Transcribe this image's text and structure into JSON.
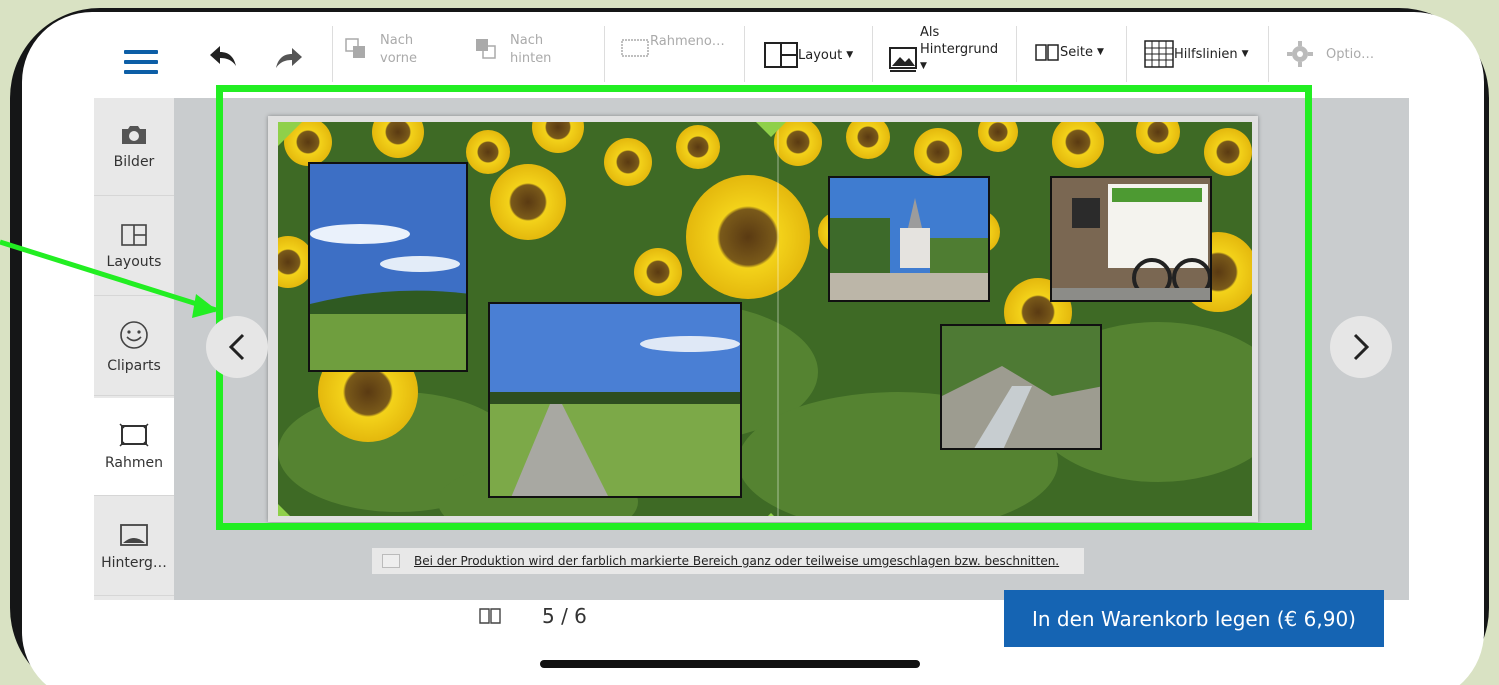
{
  "toolbar": {
    "undo_icon": "undo-arrow-icon",
    "redo_icon": "redo-arrow-icon",
    "bring_forward": {
      "line1": "Nach",
      "line2": "vorne"
    },
    "send_backward": {
      "line1": "Nach",
      "line2": "hinten"
    },
    "frame_options": "Rahmeno…",
    "layout": "Layout",
    "as_background": {
      "line1": "Als",
      "line2": "Hintergrund"
    },
    "page": "Seite",
    "guides": "Hilfslinien",
    "options": "Optio…"
  },
  "sidebar": {
    "items": [
      {
        "label": "Bilder",
        "icon": "camera-icon"
      },
      {
        "label": "Layouts",
        "icon": "layout-grid-icon"
      },
      {
        "label": "Cliparts",
        "icon": "smiley-icon"
      },
      {
        "label": "Rahmen",
        "icon": "frame-icon",
        "active": true
      },
      {
        "label": "Hinterg…",
        "icon": "background-image-icon"
      }
    ]
  },
  "notice": "Bei der Produktion wird der farblich markierte Bereich ganz oder teilweise umgeschlagen bzw. beschnitten.",
  "pagination": {
    "current": 5,
    "total": 6,
    "text": "5 / 6"
  },
  "cart_button": "In den Warenkorb legen (€ 6,90)",
  "colors": {
    "accent": "#1564b3",
    "highlight": "#22ee22",
    "menu": "#0d5ea6"
  }
}
